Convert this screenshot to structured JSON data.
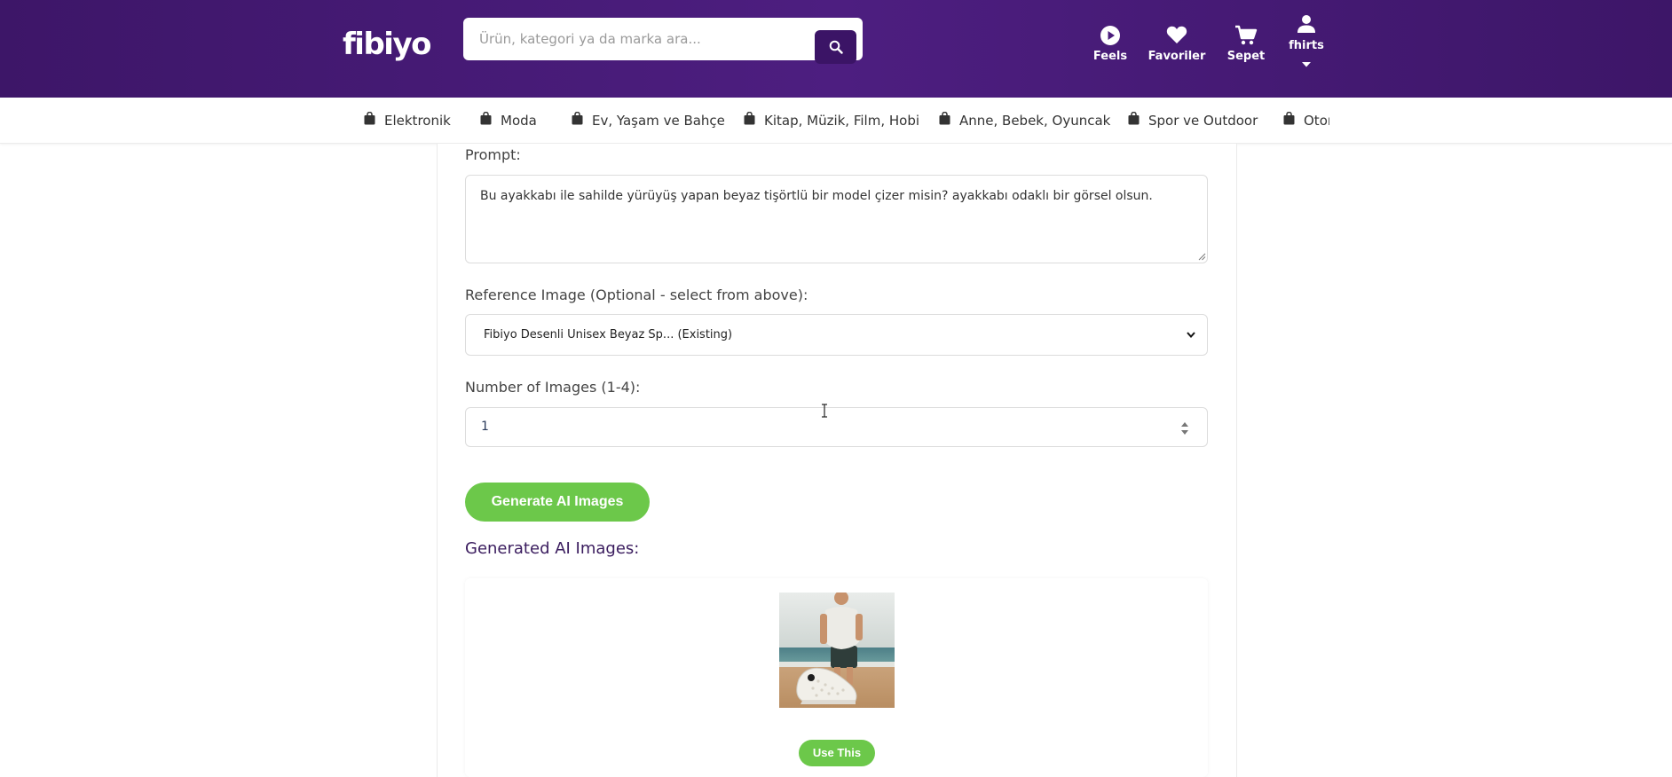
{
  "header": {
    "logo": "fibiyo",
    "search_placeholder": "Ürün, kategori ya da marka ara...",
    "items": [
      {
        "label": "Feels",
        "icon": "play-circle-icon"
      },
      {
        "label": "Favoriler",
        "icon": "heart-icon"
      },
      {
        "label": "Sepet",
        "icon": "cart-icon"
      },
      {
        "label": "fhirts",
        "icon": "user-icon"
      }
    ],
    "colors": {
      "bar": "#4a1c7c",
      "search_button": "#3b1466"
    }
  },
  "categories": [
    "Elektronik",
    "Moda",
    "Ev, Yaşam ve Bahçe",
    "Kitap, Müzik, Film, Hobi",
    "Anne, Bebek, Oyuncak",
    "Spor ve Outdoor",
    "Otor"
  ],
  "form": {
    "prompt_label": "Prompt:",
    "prompt_value": "Bu ayakkabı ile sahilde yürüyüş yapan beyaz tişörtlü bir model çizer misin? ayakkabı odaklı bir görsel olsun.",
    "reference_label": "Reference Image (Optional - select from above):",
    "reference_value": "Fibiyo Desenli Unisex Beyaz Sp... (Existing)",
    "count_label": "Number of Images (1-4):",
    "count_value": "1",
    "generate_button": "Generate AI Images",
    "generated_title": "Generated AI Images:",
    "use_button": "Use This",
    "accent": "#6cc84a"
  }
}
